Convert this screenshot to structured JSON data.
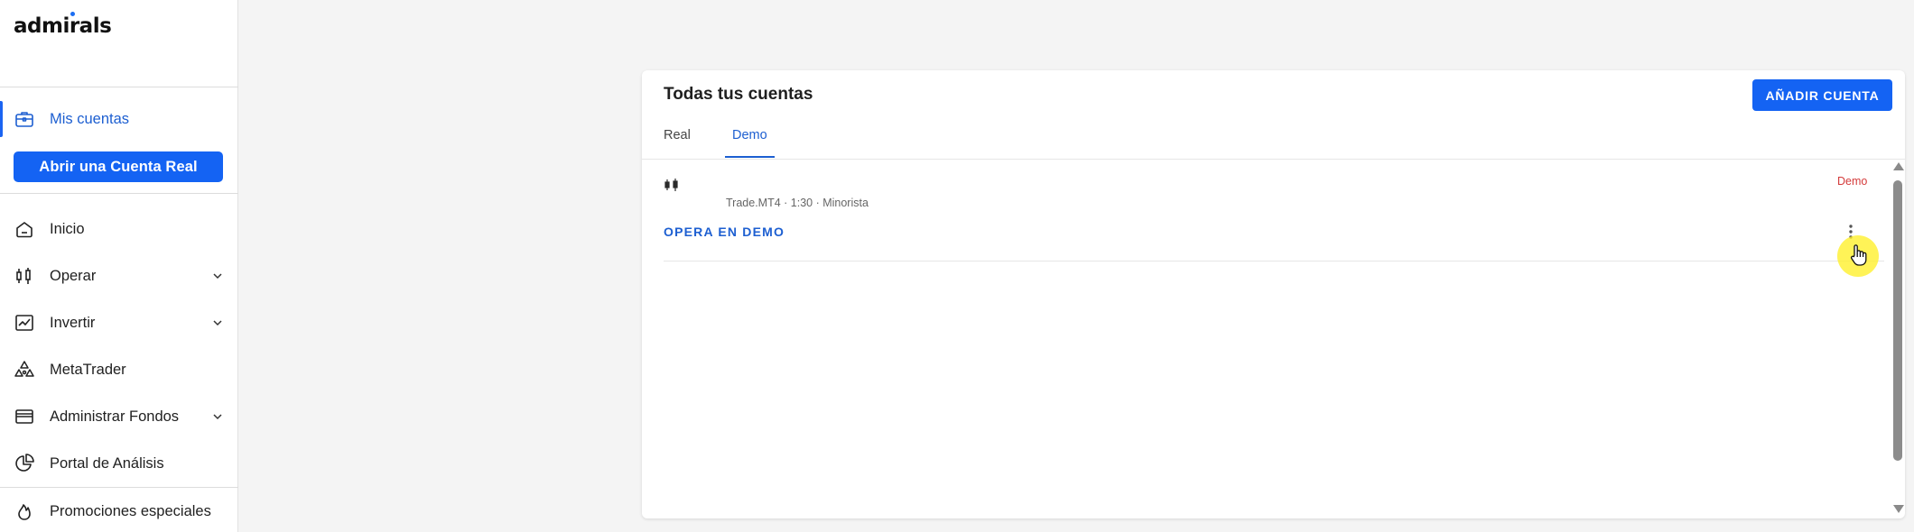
{
  "brand": {
    "name": "admirals"
  },
  "sidebar": {
    "active_item": {
      "label": "Mis cuentas",
      "icon": "briefcase-icon"
    },
    "open_real_button": "Abrir una Cuenta Real",
    "items": [
      {
        "label": "Inicio",
        "icon": "home-icon",
        "has_submenu": false
      },
      {
        "label": "Operar",
        "icon": "candlestick-icon",
        "has_submenu": true
      },
      {
        "label": "Invertir",
        "icon": "trend-chart-icon",
        "has_submenu": true
      },
      {
        "label": "MetaTrader",
        "icon": "metatrader-icon",
        "has_submenu": false
      },
      {
        "label": "Administrar Fondos",
        "icon": "wallet-icon",
        "has_submenu": true
      },
      {
        "label": "Portal de Análisis",
        "icon": "pie-chart-icon",
        "has_submenu": false
      },
      {
        "label": "Promociones especiales",
        "icon": "flame-icon",
        "has_submenu": false
      }
    ]
  },
  "main": {
    "title": "Todas tus cuentas",
    "add_account_button": "AÑADIR CUENTA",
    "tabs": [
      {
        "label": "Real",
        "active": false
      },
      {
        "label": "Demo",
        "active": true
      }
    ],
    "account": {
      "icon": "candlestick-icon",
      "info": "Trade.MT4 · 1:30 · Minorista",
      "badge": "Demo",
      "action": "OPERA EN DEMO",
      "menu_icon": "more-vertical-icon"
    }
  },
  "colors": {
    "accent": "#1463f3",
    "link": "#1d5fd1",
    "badge_demo": "#d43a3a",
    "background": "#f4f4f4"
  }
}
